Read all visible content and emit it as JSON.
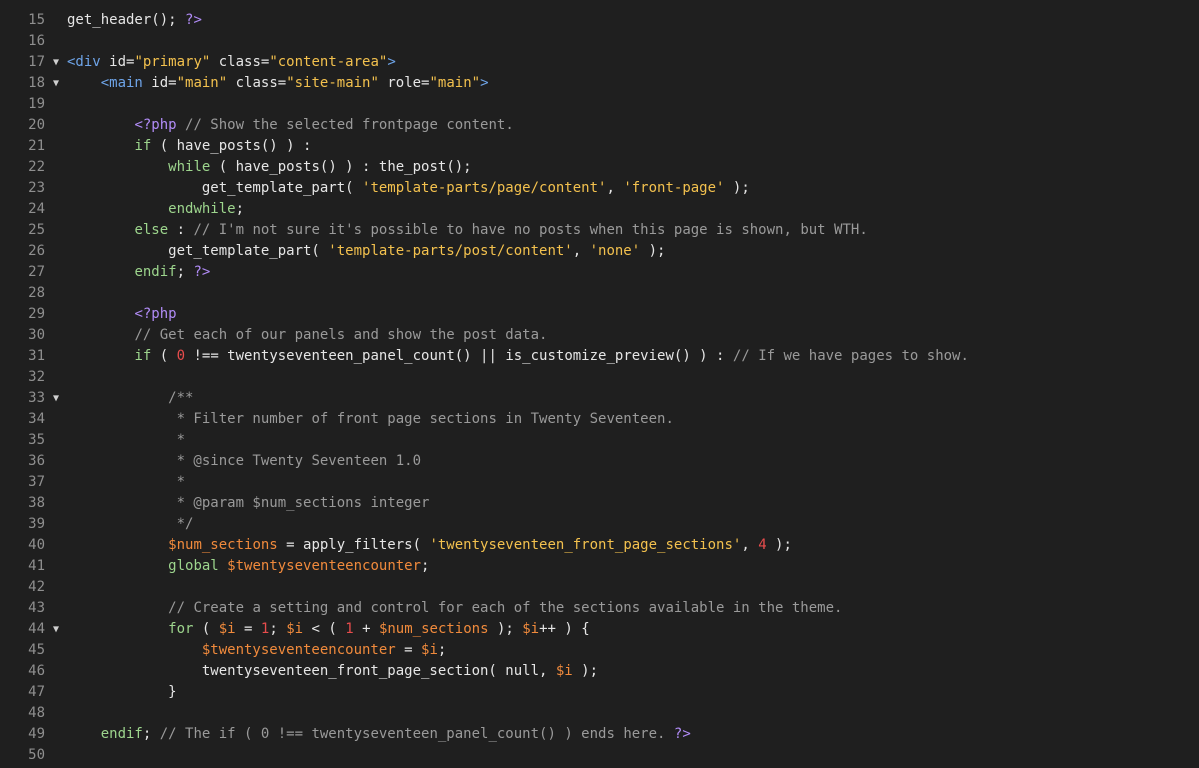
{
  "lines": [
    {
      "n": "15",
      "fold": false,
      "segs": [
        [
          "fn",
          "get_header(); "
        ],
        [
          "php",
          "?>"
        ]
      ]
    },
    {
      "n": "16",
      "fold": false,
      "segs": []
    },
    {
      "n": "17",
      "fold": true,
      "segs": [
        [
          "tag",
          "<div "
        ],
        [
          "attr",
          "id="
        ],
        [
          "str",
          "\"primary\""
        ],
        [
          "attr",
          " class="
        ],
        [
          "str",
          "\"content-area\""
        ],
        [
          "tag",
          ">"
        ]
      ]
    },
    {
      "n": "18",
      "fold": true,
      "segs": [
        [
          "fn",
          "    "
        ],
        [
          "tag",
          "<main "
        ],
        [
          "attr",
          "id="
        ],
        [
          "str",
          "\"main\""
        ],
        [
          "attr",
          " class="
        ],
        [
          "str",
          "\"site-main\""
        ],
        [
          "attr",
          " role="
        ],
        [
          "str",
          "\"main\""
        ],
        [
          "tag",
          ">"
        ]
      ]
    },
    {
      "n": "19",
      "fold": false,
      "segs": []
    },
    {
      "n": "20",
      "fold": false,
      "segs": [
        [
          "fn",
          "        "
        ],
        [
          "php",
          "<?php"
        ],
        [
          "cmt",
          " // Show the selected frontpage content."
        ]
      ]
    },
    {
      "n": "21",
      "fold": false,
      "segs": [
        [
          "fn",
          "        "
        ],
        [
          "kw",
          "if"
        ],
        [
          "fn",
          " ( have_posts() ) :"
        ]
      ]
    },
    {
      "n": "22",
      "fold": false,
      "segs": [
        [
          "fn",
          "            "
        ],
        [
          "kw",
          "while"
        ],
        [
          "fn",
          " ( have_posts() ) : the_post();"
        ]
      ]
    },
    {
      "n": "23",
      "fold": false,
      "segs": [
        [
          "fn",
          "                get_template_part( "
        ],
        [
          "str",
          "'template-parts/page/content'"
        ],
        [
          "fn",
          ", "
        ],
        [
          "str",
          "'front-page'"
        ],
        [
          "fn",
          " );"
        ]
      ]
    },
    {
      "n": "24",
      "fold": false,
      "segs": [
        [
          "fn",
          "            "
        ],
        [
          "kw",
          "endwhile"
        ],
        [
          "fn",
          ";"
        ]
      ]
    },
    {
      "n": "25",
      "fold": false,
      "segs": [
        [
          "fn",
          "        "
        ],
        [
          "kw",
          "else"
        ],
        [
          "fn",
          " : "
        ],
        [
          "cmt",
          "// I'm not sure it's possible to have no posts when this page is shown, but WTH."
        ]
      ]
    },
    {
      "n": "26",
      "fold": false,
      "segs": [
        [
          "fn",
          "            get_template_part( "
        ],
        [
          "str",
          "'template-parts/post/content'"
        ],
        [
          "fn",
          ", "
        ],
        [
          "str",
          "'none'"
        ],
        [
          "fn",
          " );"
        ]
      ]
    },
    {
      "n": "27",
      "fold": false,
      "segs": [
        [
          "fn",
          "        "
        ],
        [
          "kw",
          "endif"
        ],
        [
          "fn",
          "; "
        ],
        [
          "php",
          "?>"
        ]
      ]
    },
    {
      "n": "28",
      "fold": false,
      "segs": []
    },
    {
      "n": "29",
      "fold": false,
      "segs": [
        [
          "fn",
          "        "
        ],
        [
          "php",
          "<?php"
        ]
      ]
    },
    {
      "n": "30",
      "fold": false,
      "segs": [
        [
          "fn",
          "        "
        ],
        [
          "cmt",
          "// Get each of our panels and show the post data."
        ]
      ]
    },
    {
      "n": "31",
      "fold": false,
      "segs": [
        [
          "fn",
          "        "
        ],
        [
          "kw",
          "if"
        ],
        [
          "fn",
          " ( "
        ],
        [
          "num",
          "0"
        ],
        [
          "fn",
          " !== twentyseventeen_panel_count() || is_customize_preview() ) : "
        ],
        [
          "cmt",
          "// If we have pages to show."
        ]
      ]
    },
    {
      "n": "32",
      "fold": false,
      "segs": []
    },
    {
      "n": "33",
      "fold": true,
      "segs": [
        [
          "fn",
          "            "
        ],
        [
          "cmt",
          "/**"
        ]
      ]
    },
    {
      "n": "34",
      "fold": false,
      "segs": [
        [
          "fn",
          "             "
        ],
        [
          "cmt",
          "* Filter number of front page sections in Twenty Seventeen."
        ]
      ]
    },
    {
      "n": "35",
      "fold": false,
      "segs": [
        [
          "fn",
          "             "
        ],
        [
          "cmt",
          "*"
        ]
      ]
    },
    {
      "n": "36",
      "fold": false,
      "segs": [
        [
          "fn",
          "             "
        ],
        [
          "cmt",
          "* @since Twenty Seventeen 1.0"
        ]
      ]
    },
    {
      "n": "37",
      "fold": false,
      "segs": [
        [
          "fn",
          "             "
        ],
        [
          "cmt",
          "*"
        ]
      ]
    },
    {
      "n": "38",
      "fold": false,
      "segs": [
        [
          "fn",
          "             "
        ],
        [
          "cmt",
          "* @param $num_sections integer"
        ]
      ]
    },
    {
      "n": "39",
      "fold": false,
      "segs": [
        [
          "fn",
          "             "
        ],
        [
          "cmt",
          "*/"
        ]
      ]
    },
    {
      "n": "40",
      "fold": false,
      "segs": [
        [
          "fn",
          "            "
        ],
        [
          "var",
          "$num_sections"
        ],
        [
          "fn",
          " = apply_filters( "
        ],
        [
          "str",
          "'twentyseventeen_front_page_sections'"
        ],
        [
          "fn",
          ", "
        ],
        [
          "num",
          "4"
        ],
        [
          "fn",
          " );"
        ]
      ]
    },
    {
      "n": "41",
      "fold": false,
      "segs": [
        [
          "fn",
          "            "
        ],
        [
          "kw",
          "global"
        ],
        [
          "fn",
          " "
        ],
        [
          "var",
          "$twentyseventeencounter"
        ],
        [
          "fn",
          ";"
        ]
      ]
    },
    {
      "n": "42",
      "fold": false,
      "segs": []
    },
    {
      "n": "43",
      "fold": false,
      "segs": [
        [
          "fn",
          "            "
        ],
        [
          "cmt",
          "// Create a setting and control for each of the sections available in the theme."
        ]
      ]
    },
    {
      "n": "44",
      "fold": true,
      "segs": [
        [
          "fn",
          "            "
        ],
        [
          "kw",
          "for"
        ],
        [
          "fn",
          " ( "
        ],
        [
          "var",
          "$i"
        ],
        [
          "fn",
          " = "
        ],
        [
          "num",
          "1"
        ],
        [
          "fn",
          "; "
        ],
        [
          "var",
          "$i"
        ],
        [
          "fn",
          " < ( "
        ],
        [
          "num",
          "1"
        ],
        [
          "fn",
          " + "
        ],
        [
          "var",
          "$num_sections"
        ],
        [
          "fn",
          " ); "
        ],
        [
          "var",
          "$i"
        ],
        [
          "fn",
          "++ ) {"
        ]
      ]
    },
    {
      "n": "45",
      "fold": false,
      "segs": [
        [
          "fn",
          "                "
        ],
        [
          "var",
          "$twentyseventeencounter"
        ],
        [
          "fn",
          " = "
        ],
        [
          "var",
          "$i"
        ],
        [
          "fn",
          ";"
        ]
      ]
    },
    {
      "n": "46",
      "fold": false,
      "segs": [
        [
          "fn",
          "                twentyseventeen_front_page_section( null, "
        ],
        [
          "var",
          "$i"
        ],
        [
          "fn",
          " );"
        ]
      ]
    },
    {
      "n": "47",
      "fold": false,
      "segs": [
        [
          "fn",
          "            }"
        ]
      ]
    },
    {
      "n": "48",
      "fold": false,
      "segs": []
    },
    {
      "n": "49",
      "fold": false,
      "segs": [
        [
          "fn",
          "    "
        ],
        [
          "kw",
          "endif"
        ],
        [
          "fn",
          "; "
        ],
        [
          "cmt",
          "// The if ( 0 !== twentyseventeen_panel_count() ) ends here. "
        ],
        [
          "php",
          "?>"
        ]
      ]
    },
    {
      "n": "50",
      "fold": false,
      "segs": []
    }
  ],
  "fold_glyph": "▼"
}
